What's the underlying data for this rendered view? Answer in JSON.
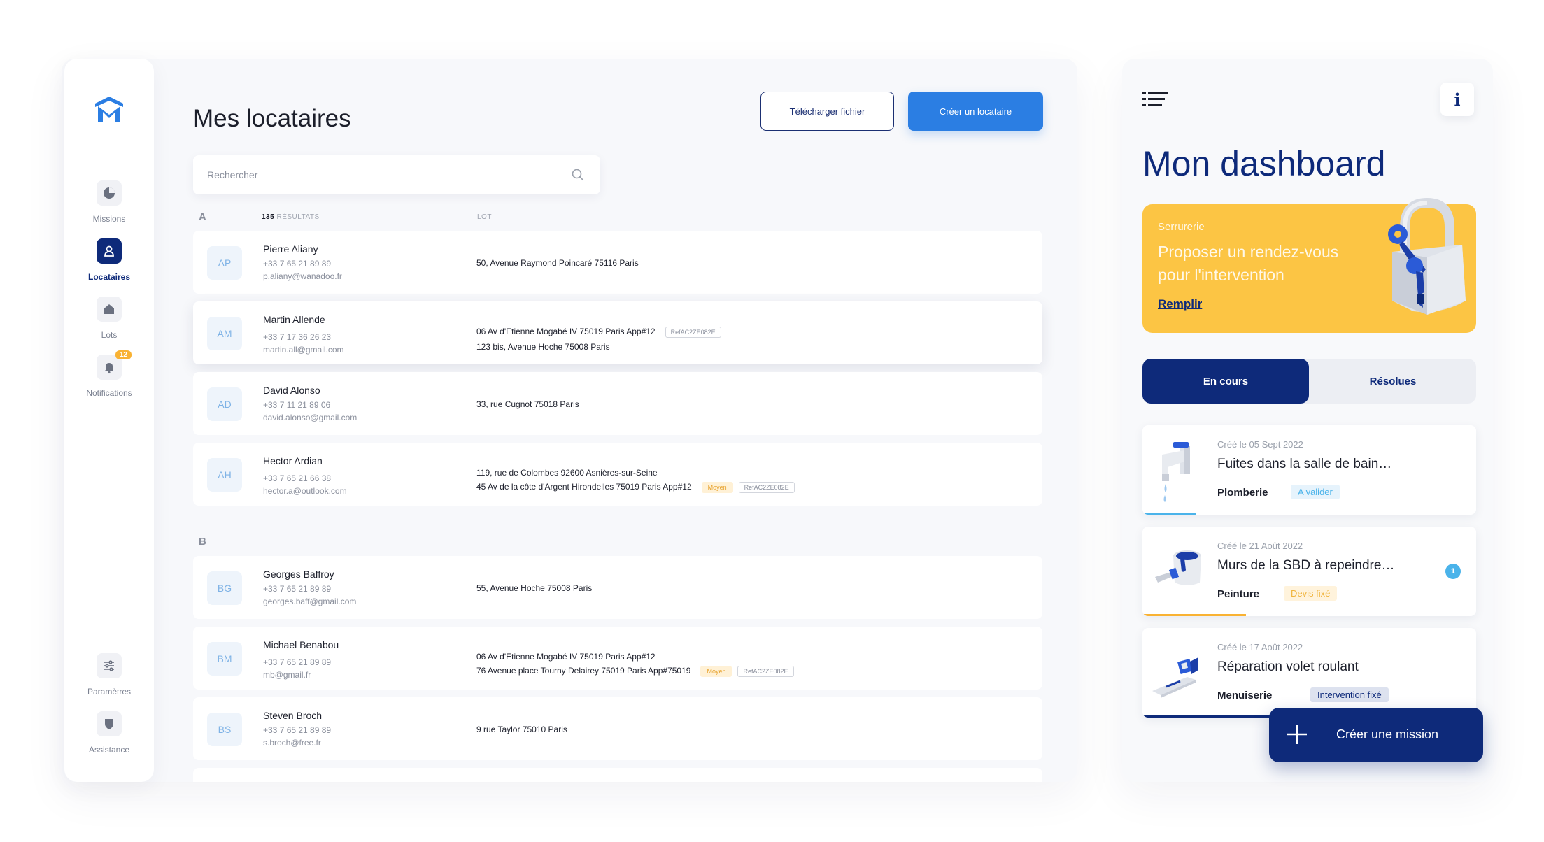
{
  "sidebar": {
    "items": [
      {
        "label": "Missions",
        "icon": "pie-chart-icon"
      },
      {
        "label": "Locataires",
        "icon": "user-icon"
      },
      {
        "label": "Lots",
        "icon": "home-icon"
      },
      {
        "label": "Notifications",
        "icon": "bell-icon",
        "badge": "12"
      }
    ],
    "bottom": [
      {
        "label": "Paramètres",
        "icon": "sliders-icon"
      },
      {
        "label": "Assistance",
        "icon": "shield-icon"
      }
    ]
  },
  "main": {
    "title": "Mes locataires",
    "download_label": "Télécharger fichier",
    "create_label": "Créer un locataire",
    "search_placeholder": "Rechercher",
    "results_count": "135",
    "results_label": "RÉSULTATS",
    "lot_header": "LOT",
    "groups": [
      {
        "letter": "A",
        "tenants": [
          {
            "initials": "AP",
            "name": "Pierre Aliany",
            "phone": "+33 7 65 21 89 89",
            "email": "p.aliany@wanadoo.fr",
            "lots": [
              {
                "address": "50, Avenue Raymond Poincaré 75116 Paris"
              }
            ]
          },
          {
            "initials": "AM",
            "name": "Martin Allende",
            "phone": "+33 7 17 36 26 23",
            "email": "martin.all@gmail.com",
            "lots": [
              {
                "address": "06 Av d'Etienne Mogabé IV 75019 Paris App#12",
                "ref": "RefAC2ZE082E"
              },
              {
                "address": "123 bis, Avenue Hoche 75008 Paris"
              }
            ]
          },
          {
            "initials": "AD",
            "name": "David Alonso",
            "phone": "+33 7 11 21 89 06",
            "email": "david.alonso@gmail.com",
            "lots": [
              {
                "address": "33, rue Cugnot 75018 Paris"
              }
            ]
          },
          {
            "initials": "AH",
            "name": "Hector Ardian",
            "phone": "+33 7 65 21 66 38",
            "email": "hector.a@outlook.com",
            "lots": [
              {
                "address": "119, rue de Colombes 92600 Asnières-sur-Seine"
              },
              {
                "address": "45 Av de la côte d'Argent Hirondelles 75019 Paris App#12",
                "tag": "Moyen",
                "ref": "RefAC2ZE082E"
              }
            ]
          }
        ]
      },
      {
        "letter": "B",
        "tenants": [
          {
            "initials": "BG",
            "name": "Georges Baffroy",
            "phone": "+33 7 65 21 89 89",
            "email": "georges.baff@gmail.com",
            "lots": [
              {
                "address": "55, Avenue Hoche 75008 Paris"
              }
            ]
          },
          {
            "initials": "BM",
            "name": "Michael Benabou",
            "phone": "+33 7 65 21 89 89",
            "email": "mb@gmail.fr",
            "lots": [
              {
                "address": "06 Av d'Etienne Mogabé IV 75019 Paris App#12"
              },
              {
                "address": "76 Avenue place Tourny Delairey 75019 Paris App#75019",
                "tag": "Moyen",
                "ref": "RefAC2ZE082E"
              }
            ]
          },
          {
            "initials": "BS",
            "name": "Steven Broch",
            "phone": "+33 7 65 21 89 89",
            "email": "s.broch@free.fr",
            "lots": [
              {
                "address": "9 rue Taylor 75010 Paris"
              }
            ]
          }
        ]
      }
    ]
  },
  "dashboard": {
    "title": "Mon dashboard",
    "info_label": "i",
    "promo": {
      "category": "Serrurerie",
      "title": "Proposer un rendez-vous pour l'intervention",
      "link": "Remplir"
    },
    "tabs": [
      {
        "label": "En cours"
      },
      {
        "label": "Résolues"
      }
    ],
    "missions": [
      {
        "date": "Créé le 05 Sept 2022",
        "title": "Fuites dans la salle de bain…",
        "category": "Plomberie",
        "status": "A valider",
        "status_bg": "#e6f3fc",
        "status_color": "#4ab3ea",
        "bar_color": "#4ab3ea",
        "progress": 0.16
      },
      {
        "date": "Créé le 21 Août 2022",
        "title": "Murs de la SBD à repeindre…",
        "category": "Peinture",
        "status": "Devis fixé",
        "status_bg": "#fff3dc",
        "status_color": "#f0b43c",
        "bar_color": "#f9b233",
        "progress": 0.31,
        "count": "1"
      },
      {
        "date": "Créé le 17 Août 2022",
        "title": "Réparation volet roulant",
        "category": "Menuiserie",
        "status": "Intervention fixé",
        "status_bg": "#dde2ef",
        "status_color": "#0e2a7a",
        "bar_color": "#0e2a7a",
        "progress": 1.0
      }
    ],
    "fab_label": "Créer une mission"
  },
  "colors": {
    "primary": "#0e2a7a",
    "accent": "#2b7ee3",
    "promo": "#fcc544"
  }
}
